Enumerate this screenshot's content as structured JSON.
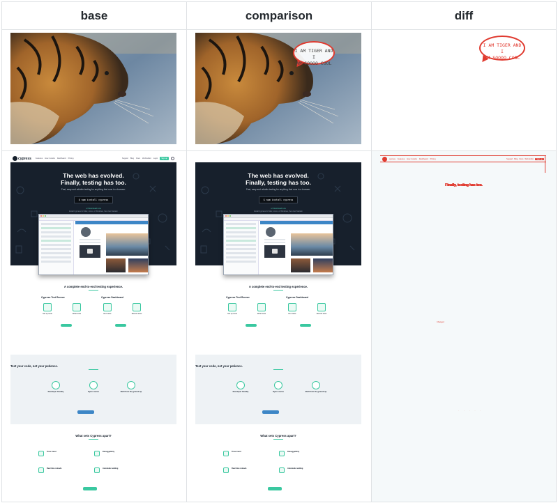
{
  "headers": {
    "base": "base",
    "comparison": "comparison",
    "diff": "diff"
  },
  "bubble": {
    "line1": "I AM TIGER AND I",
    "line2": "AM SOOOO COOL"
  },
  "site": {
    "logo": "cypress",
    "nav_links": [
      "Features",
      "How it works",
      "Dashboard",
      "Pricing"
    ],
    "nav_right": [
      "Support",
      "Blog",
      "Docs",
      "Web Editor",
      "Login"
    ],
    "nav_button": "Sign up",
    "hero_title_line1": "The web has evolved.",
    "hero_title_line2": "Finally, testing has too.",
    "hero_sub": "Fast, easy and reliable testing for anything that runs in a browser.",
    "install_cmd": "$ npm install cypress",
    "install_link": "or Download now",
    "install_small": "Install Cypress for Mac, Linux, or Windows, then Get Started.",
    "sec1_title": "A complete end-to-end testing experience.",
    "runner_title": "Cypress Test Runner",
    "dashboard_title": "Cypress Dashboard",
    "features": [
      "Set up tests",
      "Write tests",
      "Run tests",
      "Record tests"
    ],
    "sec2_title": "Test your code, not your patience.",
    "sec2_items": [
      "Developer friendly",
      "Open source",
      "Built from the ground up"
    ],
    "sec3_title": "What sets Cypress apart?",
    "sec3_items": [
      "Time travel",
      "Debuggability",
      "Real time reloads",
      "Automatic waiting"
    ]
  },
  "diff": {
    "changed_text": "Finally, testing has too.",
    "marker": "Changed"
  }
}
